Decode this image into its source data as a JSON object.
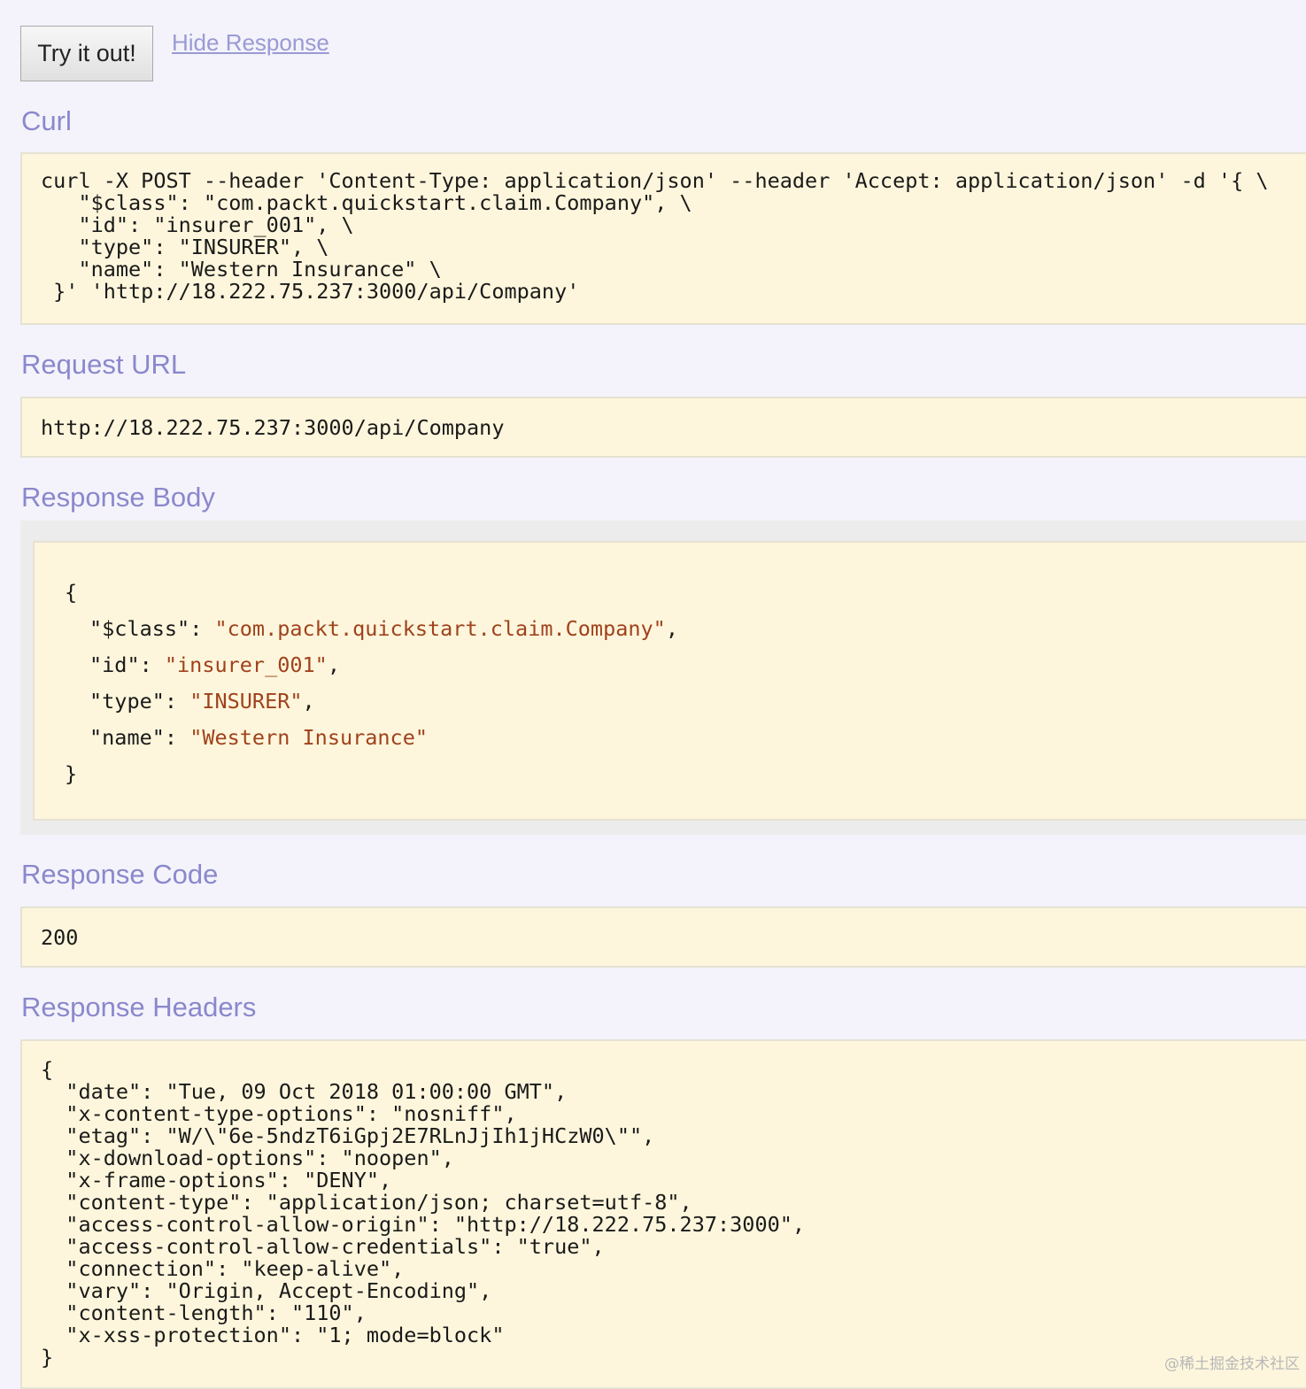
{
  "actions": {
    "try_button": "Try it out!",
    "hide_response": "Hide Response"
  },
  "curl": {
    "heading": "Curl",
    "command": "curl -X POST --header 'Content-Type: application/json' --header 'Accept: application/json' -d '{ \\\n   \"$class\": \"com.packt.quickstart.claim.Company\", \\\n   \"id\": \"insurer_001\", \\\n   \"type\": \"INSURER\", \\\n   \"name\": \"Western Insurance\" \\\n }' 'http://18.222.75.237:3000/api/Company'"
  },
  "request_url": {
    "heading": "Request URL",
    "value": "http://18.222.75.237:3000/api/Company"
  },
  "response_body": {
    "heading": "Response Body",
    "open_brace": "{",
    "close_brace": "}",
    "fields": [
      {
        "key": "\"$class\"",
        "value": "\"com.packt.quickstart.claim.Company\"",
        "trail": ","
      },
      {
        "key": "\"id\"",
        "value": "\"insurer_001\"",
        "trail": ","
      },
      {
        "key": "\"type\"",
        "value": "\"INSURER\"",
        "trail": ","
      },
      {
        "key": "\"name\"",
        "value": "\"Western Insurance\"",
        "trail": ""
      }
    ]
  },
  "response_code": {
    "heading": "Response Code",
    "value": "200"
  },
  "response_headers": {
    "heading": "Response Headers",
    "text": "{\n  \"date\": \"Tue, 09 Oct 2018 01:00:00 GMT\",\n  \"x-content-type-options\": \"nosniff\",\n  \"etag\": \"W/\\\"6e-5ndzT6iGpj2E7RLnJjIh1jHCzW0\\\"\",\n  \"x-download-options\": \"noopen\",\n  \"x-frame-options\": \"DENY\",\n  \"content-type\": \"application/json; charset=utf-8\",\n  \"access-control-allow-origin\": \"http://18.222.75.237:3000\",\n  \"access-control-allow-credentials\": \"true\",\n  \"connection\": \"keep-alive\",\n  \"vary\": \"Origin, Accept-Encoding\",\n  \"content-length\": \"110\",\n  \"x-xss-protection\": \"1; mode=block\"\n}"
  },
  "watermark": "@稀土掘金技术社区"
}
